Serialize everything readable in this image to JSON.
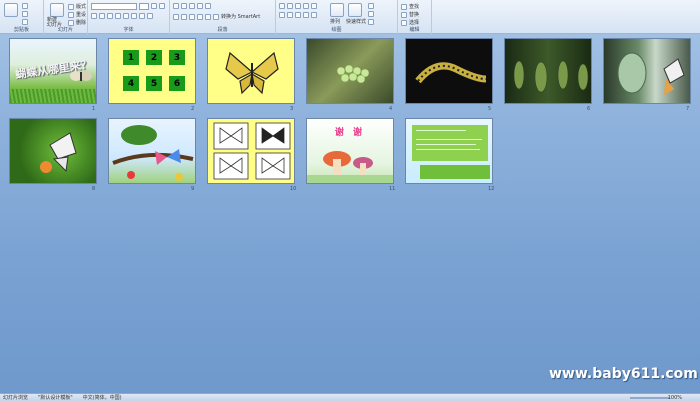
{
  "ribbon": {
    "groups": [
      {
        "label": "剪贴板"
      },
      {
        "label": "幻灯片"
      },
      {
        "label": "字体"
      },
      {
        "label": "段落"
      },
      {
        "label": "绘图"
      },
      {
        "label": "编辑"
      }
    ],
    "new_slide_label": "新建\n幻灯片",
    "arrange_label": "排列",
    "quick_styles_label": "快速样式",
    "layout_label": "版式",
    "reset_label": "重设",
    "delete_label": "删除",
    "smartart_label": "转换为 SmartArt",
    "find_label": "查找",
    "replace_label": "替换",
    "select_label": "选择"
  },
  "slides": [
    {
      "num": "1",
      "title": "蝴蝶从哪里来？"
    },
    {
      "num": "2",
      "numbers": [
        "1",
        "2",
        "3",
        "4",
        "5",
        "6"
      ]
    },
    {
      "num": "3"
    },
    {
      "num": "4"
    },
    {
      "num": "5"
    },
    {
      "num": "6"
    },
    {
      "num": "7"
    },
    {
      "num": "8"
    },
    {
      "num": "9"
    },
    {
      "num": "10"
    },
    {
      "num": "11",
      "title": "谢 谢"
    },
    {
      "num": "12"
    }
  ],
  "watermark": "www.baby611.com",
  "status": {
    "slide_view": "幻灯片浏览",
    "theme": "\"默认设计模板\"",
    "language": "中文(简体，中国)",
    "zoom": "100%"
  }
}
